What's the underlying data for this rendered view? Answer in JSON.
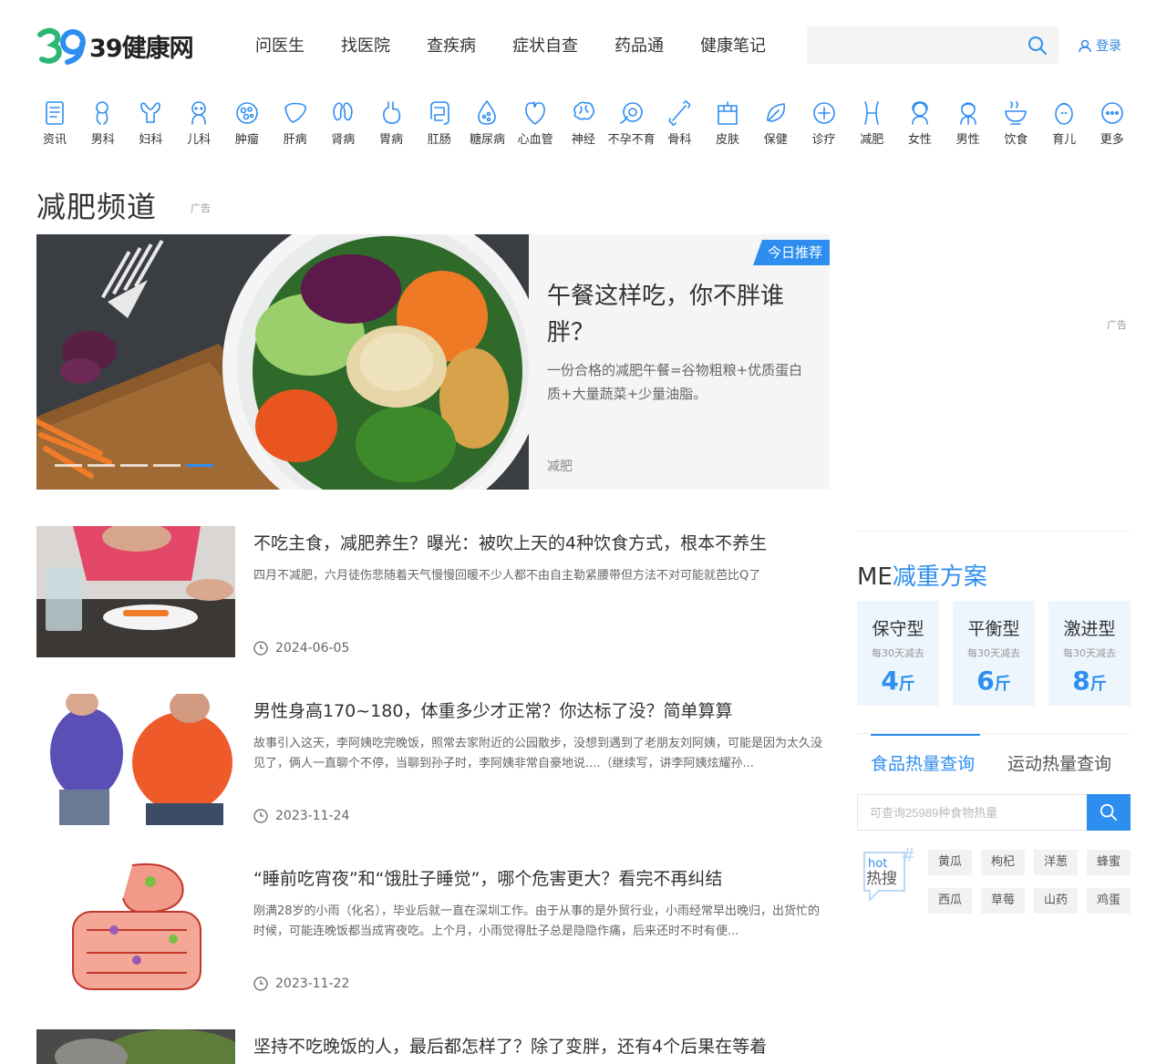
{
  "header": {
    "logo_number": "39",
    "logo_text": "39健康网",
    "nav": [
      "问医生",
      "找医院",
      "查疾病",
      "症状自查",
      "药品通",
      "健康笔记"
    ],
    "search_placeholder": "",
    "login": "登录"
  },
  "categories": [
    {
      "label": "资讯",
      "icon": "news-icon"
    },
    {
      "label": "男科",
      "icon": "male-organ-icon"
    },
    {
      "label": "妇科",
      "icon": "uterus-icon"
    },
    {
      "label": "儿科",
      "icon": "baby-icon"
    },
    {
      "label": "肿瘤",
      "icon": "cell-icon"
    },
    {
      "label": "肝病",
      "icon": "liver-icon"
    },
    {
      "label": "肾病",
      "icon": "kidney-icon"
    },
    {
      "label": "胃病",
      "icon": "stomach-icon"
    },
    {
      "label": "肛肠",
      "icon": "intestine-icon"
    },
    {
      "label": "糖尿病",
      "icon": "drop-icon"
    },
    {
      "label": "心血管",
      "icon": "heart-icon"
    },
    {
      "label": "神经",
      "icon": "brain-icon"
    },
    {
      "label": "不孕不育",
      "icon": "sperm-egg-icon"
    },
    {
      "label": "骨科",
      "icon": "bone-icon"
    },
    {
      "label": "皮肤",
      "icon": "skin-icon"
    },
    {
      "label": "保健",
      "icon": "leaf-icon"
    },
    {
      "label": "诊疗",
      "icon": "medical-cross-icon"
    },
    {
      "label": "减肥",
      "icon": "waist-icon"
    },
    {
      "label": "女性",
      "icon": "woman-icon"
    },
    {
      "label": "男性",
      "icon": "man-icon"
    },
    {
      "label": "饮食",
      "icon": "bowl-icon"
    },
    {
      "label": "育儿",
      "icon": "infant-icon"
    },
    {
      "label": "更多",
      "icon": "more-icon"
    }
  ],
  "channel": {
    "title": "减肥频道",
    "ad_label": "广告"
  },
  "hero": {
    "tag": "今日推荐",
    "title": "午餐这样吃，你不胖谁胖？",
    "desc": "一份合格的减肥午餐=谷物粗粮+优质蛋白质+大量蔬菜+少量油脂。",
    "category": "减肥",
    "slide_count": 5,
    "active_slide": 5
  },
  "articles": [
    {
      "title": "不吃主食，减肥养生？曝光：被吹上天的4种饮食方式，根本不养生",
      "desc": "四月不减肥，六月徒伤悲随着天气慢慢回暖不少人都不由自主勒紧腰带但方法不对可能就芭比Q了",
      "date": "2024-06-05",
      "thumb": "woman-eating-carrot"
    },
    {
      "title": "男性身高170~180，体重多少才正常？你达标了没？简单算算",
      "desc": "故事引入这天，李阿姨吃完晚饭，照常去家附近的公园散步，没想到遇到了老朋友刘阿姨，可能是因为太久没见了，俩人一直聊个不停，当聊到孙子时，李阿姨非常自豪地说....（继续写，讲李阿姨炫耀孙...",
      "date": "2023-11-24",
      "thumb": "two-men-belly"
    },
    {
      "title": "“睡前吃宵夜”和“饿肚子睡觉”，哪个危害更大？看完不再纠结",
      "desc": "刚满28岁的小雨（化名），毕业后就一直在深圳工作。由于从事的是外贸行业，小雨经常早出晚归，出货忙的时候，可能连晚饭都当成宵夜吃。上个月，小雨觉得肚子总是隐隐作痛，后来还时不时有便...",
      "date": "2023-11-22",
      "thumb": "intestine-illustration"
    },
    {
      "title": "坚持不吃晚饭的人，最后都怎样了？除了变胖，还有4个后果在等着",
      "desc": "",
      "date": "",
      "thumb": "food-plate"
    }
  ],
  "sidebar": {
    "ad_label": "广告",
    "me_prefix": "ME",
    "me_title": "减重方案",
    "plans": [
      {
        "name": "保守型",
        "sub": "每30天减去",
        "value": "4",
        "unit": "斤"
      },
      {
        "name": "平衡型",
        "sub": "每30天减去",
        "value": "6",
        "unit": "斤"
      },
      {
        "name": "激进型",
        "sub": "每30天减去",
        "value": "8",
        "unit": "斤"
      }
    ],
    "tabs": [
      "食品热量查询",
      "运动热量查询"
    ],
    "food_placeholder": "可查询25989种食物热量",
    "hot_label_en": "hot",
    "hot_label_cn": "热搜",
    "hot_items": [
      "黄瓜",
      "枸杞",
      "洋葱",
      "蜂蜜",
      "西瓜",
      "草莓",
      "山药",
      "鸡蛋"
    ]
  },
  "colors": {
    "accent": "#2e8ef0",
    "text": "#333333",
    "muted": "#999999"
  }
}
